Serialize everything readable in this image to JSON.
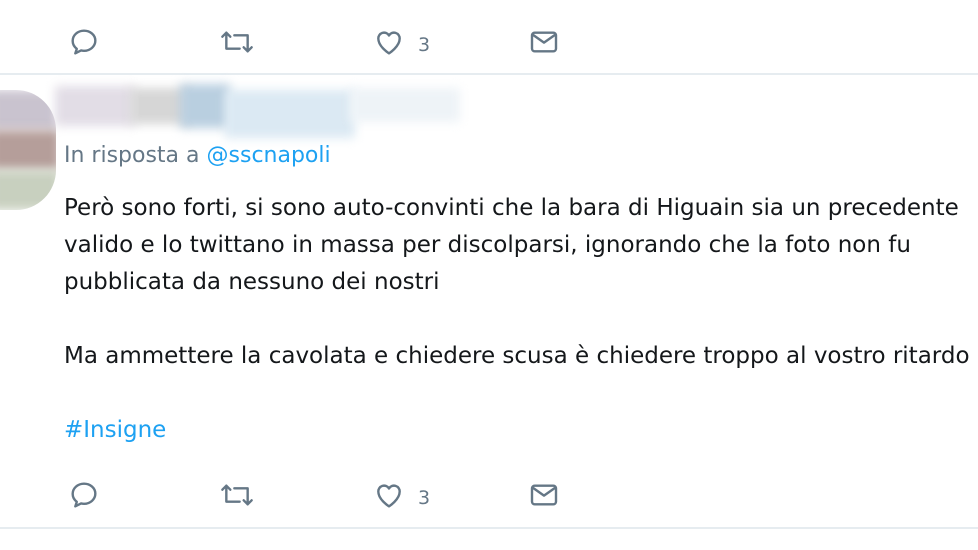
{
  "top_actions": {
    "like_count": "3"
  },
  "reply": {
    "prefix": "In risposta a",
    "handle": "@sscnapoli"
  },
  "tweet": {
    "lines": [
      "Però sono forti, si sono auto-convinti che la bara di Higuain sia un precedente",
      "valido e lo twittano in massa per discolparsi, ignorando che la foto non fu",
      "pubblicata da nessuno dei nostri",
      "Ma ammettere la cavolata e chiedere scusa è chiedere troppo al vostro ritardo"
    ],
    "hashtag": "#Insigne"
  },
  "bottom_actions": {
    "like_count": "3"
  },
  "icons": [
    "reply-icon",
    "retweet-icon",
    "like-icon",
    "direct-message-icon"
  ],
  "colors": {
    "link": "#1da1f2",
    "muted": "#657786",
    "text": "#14171a",
    "divider": "#e6ecf0"
  }
}
